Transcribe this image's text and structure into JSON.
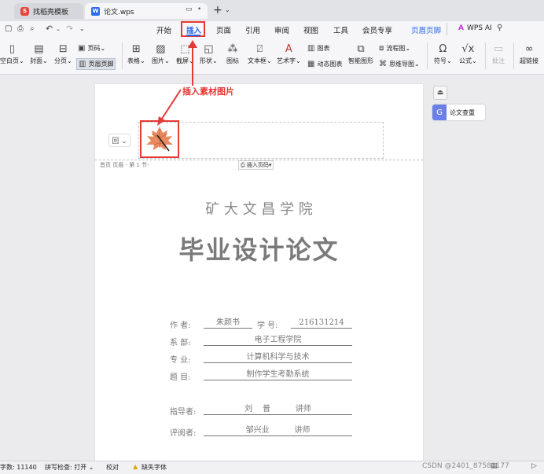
{
  "tabs": [
    {
      "label": "找稻壳模板"
    },
    {
      "label": "论文.wps"
    }
  ],
  "menu": {
    "items": [
      "开始",
      "插入",
      "页面",
      "引用",
      "审阅",
      "视图",
      "工具",
      "会员专享",
      "页眉页脚"
    ],
    "wps_ai": "WPS AI"
  },
  "ribbon": {
    "blank_page": "空白页",
    "cover": "封面",
    "page_break": "分页",
    "page_number": "页码",
    "header_footer": "页眉页脚",
    "table": "表格",
    "picture": "图片",
    "screenshot": "截屏",
    "shape": "形状",
    "icon": "图标",
    "textbox": "文本框",
    "wordart": "艺术字",
    "chart": "图表",
    "dynamic_chart": "动态图表",
    "smart_graphic": "智能图形",
    "flowchart": "流程图",
    "mindmap": "思维导图",
    "symbol": "符号",
    "formula": "公式",
    "comment": "批注",
    "hyperlink": "超链接"
  },
  "annotation": {
    "text": "插入素材图片",
    "color": "#e53935"
  },
  "side_panel": {
    "plagiarism_check": "论文查重"
  },
  "header_area": {
    "label": "首页 页眉 - 第 1 节-",
    "insert_page_number": "插入页码"
  },
  "document": {
    "school": "矿 大 文 昌 学 院",
    "title": "毕业设计论文",
    "fields": [
      {
        "label": "作    者:",
        "value": "朱颜书"
      },
      {
        "label": "学    号:",
        "value": "216131214"
      },
      {
        "label": "系    部:",
        "value": "电子工程学院"
      },
      {
        "label": "专    业:",
        "value": "计算机科学与技术"
      },
      {
        "label": "题    目:",
        "value": "制作学生考勤系统"
      },
      {
        "label": "指导者:",
        "value": "刘    普          讲师"
      },
      {
        "label": "评阅者:",
        "value": "邹兴业          讲师"
      }
    ]
  },
  "status": {
    "word_count": "字数: 11140",
    "spell_check": "拼写检查: 打开",
    "proofread": "校对",
    "missing_font": "缺失字体",
    "watermark": "CSDN @2401_87581177"
  },
  "colors": {
    "accent": "#2f6bf2",
    "annotation": "#e53935",
    "leaf": "#e8895e"
  }
}
